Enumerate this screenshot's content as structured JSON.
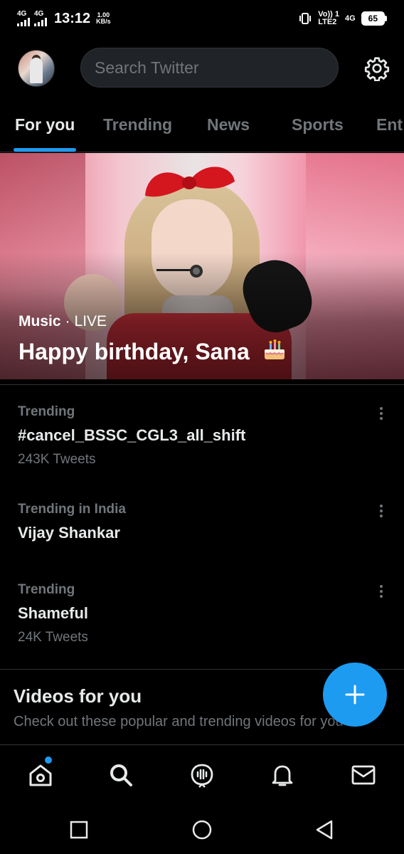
{
  "status_bar": {
    "sim1_net": "4G",
    "sim2_net": "4G",
    "time": "13:12",
    "speed_value": "1.00",
    "speed_unit": "KB/s",
    "volte": "Vo)) 1",
    "lte": "LTE2",
    "net2": "4G",
    "battery": "65"
  },
  "header": {
    "search_placeholder": "Search Twitter",
    "avatar_icon": "user-avatar",
    "settings_icon": "gear-icon"
  },
  "tabs": [
    {
      "label": "For you",
      "active": true
    },
    {
      "label": "Trending",
      "active": false
    },
    {
      "label": "News",
      "active": false
    },
    {
      "label": "Sports",
      "active": false
    },
    {
      "label": "Ent",
      "active": false
    }
  ],
  "hero": {
    "category": "Music",
    "separator": "·",
    "status": "LIVE",
    "title": "Happy birthday, Sana",
    "emoji_icon": "birthday-cake-icon"
  },
  "trends": [
    {
      "context": "Trending",
      "name": "#cancel_BSSC_CGL3_all_shift",
      "count": "243K Tweets"
    },
    {
      "context": "Trending in India",
      "name": "Vijay Shankar",
      "count": ""
    },
    {
      "context": "Trending",
      "name": "Shameful",
      "count": "24K Tweets"
    }
  ],
  "videos": {
    "title": "Videos for you",
    "subtitle": "Check out these popular and trending videos for you"
  },
  "fab_icon": "plus-icon",
  "bottom_nav": [
    {
      "icon": "home-icon",
      "has_dot": true
    },
    {
      "icon": "search-icon",
      "has_dot": false
    },
    {
      "icon": "spaces-icon",
      "has_dot": false
    },
    {
      "icon": "bell-icon",
      "has_dot": false
    },
    {
      "icon": "mail-icon",
      "has_dot": false
    }
  ],
  "colors": {
    "accent": "#1d9bf0",
    "background": "#000000",
    "secondary_text": "#71767b"
  }
}
